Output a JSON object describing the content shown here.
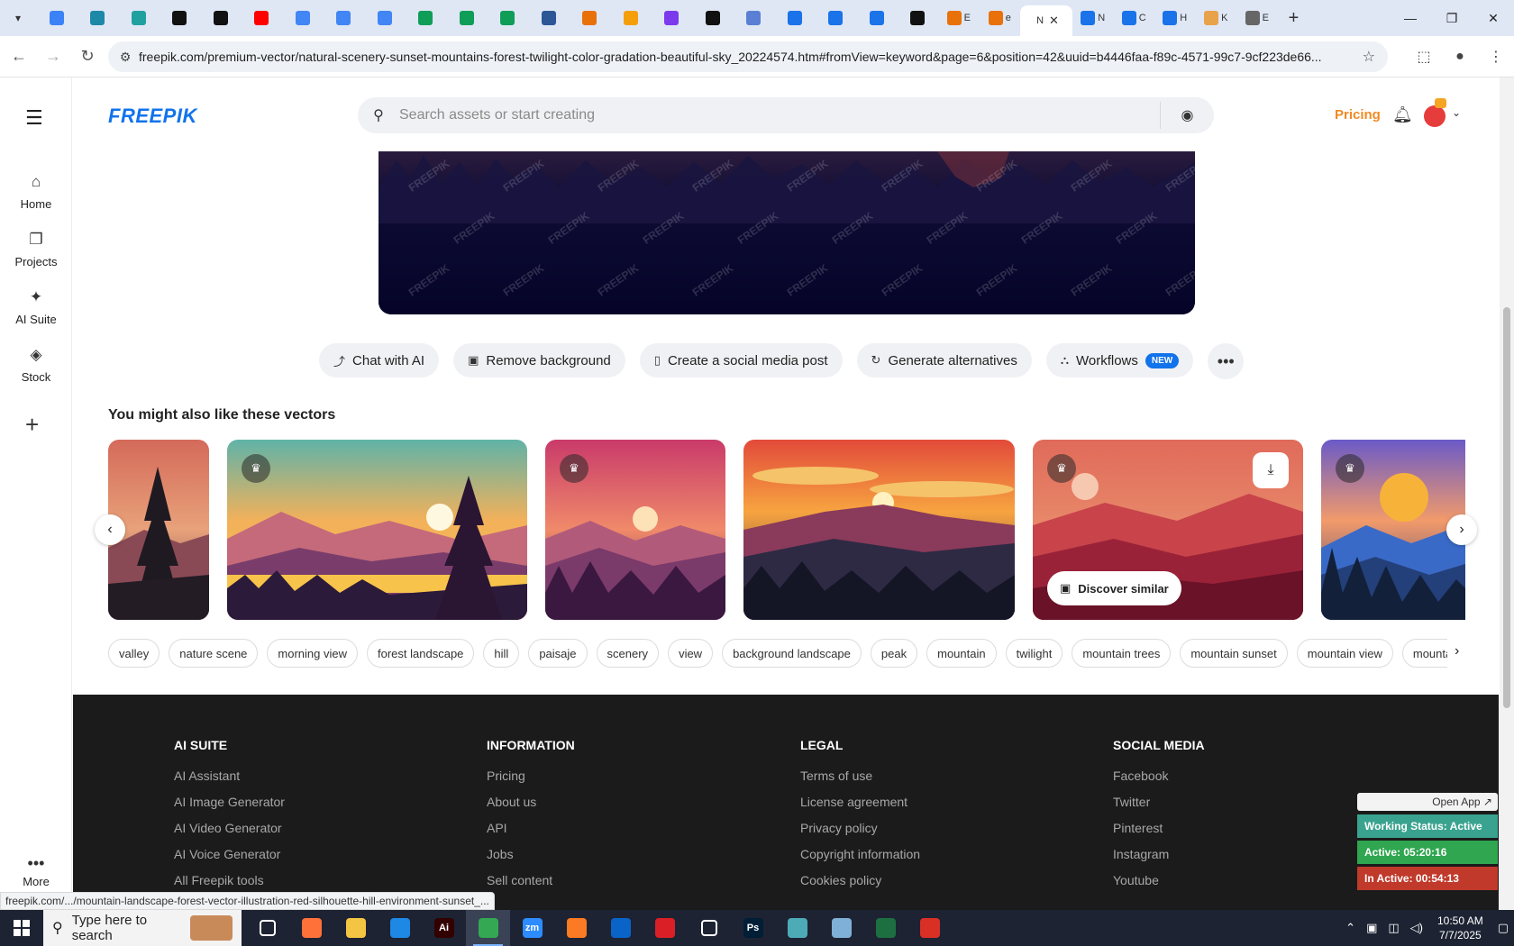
{
  "browser": {
    "tabs": [
      {
        "icon": "globe-icon",
        "color": "#3b82f6"
      },
      {
        "icon": "wordpress-icon",
        "color": "#1e88a8"
      },
      {
        "icon": "arrow-icon",
        "color": "#21a0a0"
      },
      {
        "icon": "openai-icon",
        "color": "#111111"
      },
      {
        "icon": "bolt-icon",
        "color": "#111111"
      },
      {
        "icon": "youtube-icon",
        "color": "#ff0000"
      },
      {
        "icon": "docs-icon",
        "color": "#4285f4"
      },
      {
        "icon": "docs-icon",
        "color": "#4285f4"
      },
      {
        "icon": "docs-icon",
        "color": "#4285f4"
      },
      {
        "icon": "sheets-icon",
        "color": "#0f9d58"
      },
      {
        "icon": "sheets-icon",
        "color": "#0f9d58"
      },
      {
        "icon": "sheets-icon",
        "color": "#0f9d58"
      },
      {
        "icon": "word-icon",
        "color": "#2b5797"
      },
      {
        "icon": "grid-icon",
        "color": "#e8710a"
      },
      {
        "icon": "flag-icon",
        "color": "#f59e0b"
      },
      {
        "icon": "code-icon",
        "color": "#7c3aed"
      },
      {
        "icon": "editor-icon",
        "color": "#111111"
      },
      {
        "icon": "table-icon",
        "color": "#5b7fd4"
      },
      {
        "icon": "form-icon",
        "color": "#1a73e8"
      },
      {
        "icon": "form-icon",
        "color": "#1a73e8"
      },
      {
        "icon": "form-icon",
        "color": "#1a73e8"
      },
      {
        "icon": "medium-icon",
        "color": "#111111"
      }
    ],
    "labeled_tabs": [
      {
        "label": "E",
        "color": "#e8710a"
      },
      {
        "label": "e",
        "color": "#e8710a"
      }
    ],
    "active_tab": {
      "label": "N",
      "color": "#111111"
    },
    "after_tabs": [
      {
        "label": "N",
        "color": "#1a73e8"
      },
      {
        "label": "C",
        "color": "#1a73e8"
      },
      {
        "label": "H",
        "color": "#1a73e8"
      },
      {
        "label": "K",
        "color": "#e8a24a"
      },
      {
        "label": "E",
        "color": "#666666"
      }
    ],
    "url": "freepik.com/premium-vector/natural-scenery-sunset-mountains-forest-twilight-color-gradation-beautiful-sky_20224574.htm#fromView=keyword&page=6&position=42&uuid=b4446faa-f89c-4571-99c7-9cf223de66...",
    "status_url": "freepik.com/.../mountain-landscape-forest-vector-illustration-red-silhouette-hill-environment-sunset_..."
  },
  "rail": {
    "items": [
      {
        "label": "Home",
        "icon": "home-icon"
      },
      {
        "label": "Projects",
        "icon": "folder-icon"
      },
      {
        "label": "AI Suite",
        "icon": "sparkle-icon"
      },
      {
        "label": "Stock",
        "icon": "shapes-icon"
      }
    ],
    "more_label": "More"
  },
  "header": {
    "logo": "FREEPIK",
    "search_placeholder": "Search assets or start creating",
    "pricing": "Pricing"
  },
  "actions": [
    {
      "label": "Chat with AI",
      "icon": "chat-icon"
    },
    {
      "label": "Remove background",
      "icon": "remove-bg-icon"
    },
    {
      "label": "Create a social media post",
      "icon": "phone-icon"
    },
    {
      "label": "Generate alternatives",
      "icon": "refresh-icon"
    },
    {
      "label": "Workflows",
      "icon": "workflow-icon",
      "badge": "NEW"
    }
  ],
  "section_title": "You might also like these vectors",
  "card_hover": {
    "discover_label": "Discover similar"
  },
  "tags": [
    "valley",
    "nature scene",
    "morning view",
    "forest landscape",
    "hill",
    "paisaje",
    "scenery",
    "view",
    "background landscape",
    "peak",
    "mountain",
    "twilight",
    "mountain trees",
    "mountain sunset",
    "mountain view",
    "mountain sky"
  ],
  "footer": {
    "columns": [
      {
        "title": "AI SUITE",
        "links": [
          "AI Assistant",
          "AI Image Generator",
          "AI Video Generator",
          "AI Voice Generator",
          "All Freepik tools"
        ]
      },
      {
        "title": "INFORMATION",
        "links": [
          "Pricing",
          "About us",
          "API",
          "Jobs",
          "Sell content"
        ]
      },
      {
        "title": "LEGAL",
        "links": [
          "Terms of use",
          "License agreement",
          "Privacy policy",
          "Copyright information",
          "Cookies policy"
        ]
      },
      {
        "title": "SOCIAL MEDIA",
        "links": [
          "Facebook",
          "Twitter",
          "Pinterest",
          "Instagram",
          "Youtube"
        ]
      }
    ]
  },
  "widget": {
    "open_app": "Open App ↗",
    "working_status": "Working Status: Active",
    "active": "Active: 05:20:16",
    "inactive": "In Active: 00:54:13",
    "colors": {
      "status": "#3aa38f",
      "active": "#2fa64f",
      "inactive": "#c0392b"
    }
  },
  "taskbar": {
    "search_placeholder": "Type here to search",
    "time": "10:50 AM",
    "date": "7/7/2025",
    "apps": [
      {
        "name": "task-view-icon",
        "label": "",
        "color": "transparent"
      },
      {
        "name": "firefox-icon",
        "label": "",
        "color": "#ff7139"
      },
      {
        "name": "file-explorer-icon",
        "label": "",
        "color": "#f4c542"
      },
      {
        "name": "vscode-icon",
        "label": "",
        "color": "#1e88e5"
      },
      {
        "name": "illustrator-icon",
        "label": "Ai",
        "color": "#330000"
      },
      {
        "name": "chrome-icon",
        "label": "",
        "color": "#34a853"
      },
      {
        "name": "zoom-icon",
        "label": "zm",
        "color": "#2d8cff"
      },
      {
        "name": "xampp-icon",
        "label": "",
        "color": "#fb7a24"
      },
      {
        "name": "outlook-icon",
        "label": "",
        "color": "#0a64c8"
      },
      {
        "name": "creative-cloud-icon",
        "label": "",
        "color": "#da1f26"
      },
      {
        "name": "pen-tool-icon",
        "label": "",
        "color": "transparent"
      },
      {
        "name": "photoshop-icon",
        "label": "Ps",
        "color": "#001e36"
      },
      {
        "name": "app-diamond-icon",
        "label": "",
        "color": "#4dabb8"
      },
      {
        "name": "notepad-icon",
        "label": "",
        "color": "#7fb0d8"
      },
      {
        "name": "excel-icon",
        "label": "",
        "color": "#1d6f42"
      },
      {
        "name": "app-red-icon",
        "label": "",
        "color": "#d93025"
      }
    ]
  }
}
